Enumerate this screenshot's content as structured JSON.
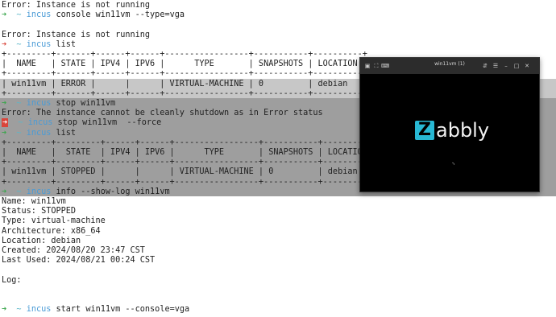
{
  "terminal": {
    "lines": [
      {
        "type": "plain",
        "text": "Error: Instance is not running"
      },
      {
        "type": "prompt",
        "arrow": "green",
        "cmd": "incus",
        "args": "console win11vm --type=vga"
      },
      {
        "type": "plain",
        "text": ""
      },
      {
        "type": "plain",
        "text": "Error: Instance is not running"
      },
      {
        "type": "prompt",
        "arrow": "red",
        "cmd": "incus",
        "args": "list"
      },
      {
        "type": "plain",
        "text": "+---------+-------+------+------+-----------------+-----------+----------+"
      },
      {
        "type": "plain",
        "text": "|  NAME   | STATE | IPV4 | IPV6 |      TYPE       | SNAPSHOTS | LOCATION |"
      },
      {
        "type": "plain",
        "text": "+---------+-------+------+------+-----------------+-----------+----------+"
      },
      {
        "type": "plain",
        "text": "| win11vm | ERROR |      |      | VIRTUAL-MACHINE | 0         | debian   |"
      },
      {
        "type": "plain",
        "text": "+---------+-------+------+------+-----------------+-----------+----------+"
      },
      {
        "type": "prompt",
        "arrow": "green",
        "cmd": "incus",
        "args": "stop win11vm"
      },
      {
        "type": "plain",
        "text": "Error: The instance cannot be cleanly shutdown as in Error status"
      },
      {
        "type": "prompt",
        "arrow": "red",
        "cmd": "incus",
        "args": "stop win11vm  --force"
      },
      {
        "type": "prompt",
        "arrow": "green",
        "cmd": "incus",
        "args": "list"
      },
      {
        "type": "plain",
        "text": "+---------+---------+------+------+-----------------+-----------+----------+"
      },
      {
        "type": "plain",
        "text": "|  NAME   |  STATE  | IPV4 | IPV6 |      TYPE       | SNAPSHOTS | LOCATION |"
      },
      {
        "type": "plain",
        "text": "+---------+---------+------+------+-----------------+-----------+----------+"
      },
      {
        "type": "plain",
        "text": "| win11vm | STOPPED |      |      | VIRTUAL-MACHINE | 0         | debian   |"
      },
      {
        "type": "plain",
        "text": "+---------+---------+------+------+-----------------+-----------+----------+"
      },
      {
        "type": "prompt",
        "arrow": "green",
        "cmd": "incus",
        "args": "info --show-log win11vm"
      },
      {
        "type": "plain",
        "text": "Name: win11vm"
      },
      {
        "type": "plain",
        "text": "Status: STOPPED"
      },
      {
        "type": "plain",
        "text": "Type: virtual-machine"
      },
      {
        "type": "plain",
        "text": "Architecture: x86_64"
      },
      {
        "type": "plain",
        "text": "Location: debian"
      },
      {
        "type": "plain",
        "text": "Created: 2024/08/20 23:47 CST"
      },
      {
        "type": "plain",
        "text": "Last Used: 2024/08/21 00:24 CST"
      },
      {
        "type": "plain",
        "text": ""
      },
      {
        "type": "plain",
        "text": "Log:"
      },
      {
        "type": "plain",
        "text": ""
      },
      {
        "type": "plain",
        "text": ""
      },
      {
        "type": "prompt",
        "arrow": "green",
        "cmd": "incus",
        "args": "start win11vm --console=vga"
      }
    ],
    "prompt_arrow": "➜",
    "prompt_dir": "~",
    "colors": {
      "arrow_green": "#3aa64c",
      "arrow_red": "#d9453a",
      "dir": "#5bb7c9",
      "command": "#4a9bd6",
      "text": "#1f1f1f",
      "highlight_light": "#c7c7c7",
      "highlight_dark": "#9e9e9e"
    }
  },
  "vm_window": {
    "title": "win11vm (1)",
    "header_icons_left": [
      "screenshot-icon",
      "fullscreen-icon",
      "keyboard-icon"
    ],
    "header_icons_right": [
      "usb-icon",
      "menu-icon",
      "minimize-icon",
      "maximize-icon",
      "close-icon"
    ],
    "logo_letter": "Z",
    "logo_rest": "abbly",
    "logo_color": "#28b8d4"
  }
}
